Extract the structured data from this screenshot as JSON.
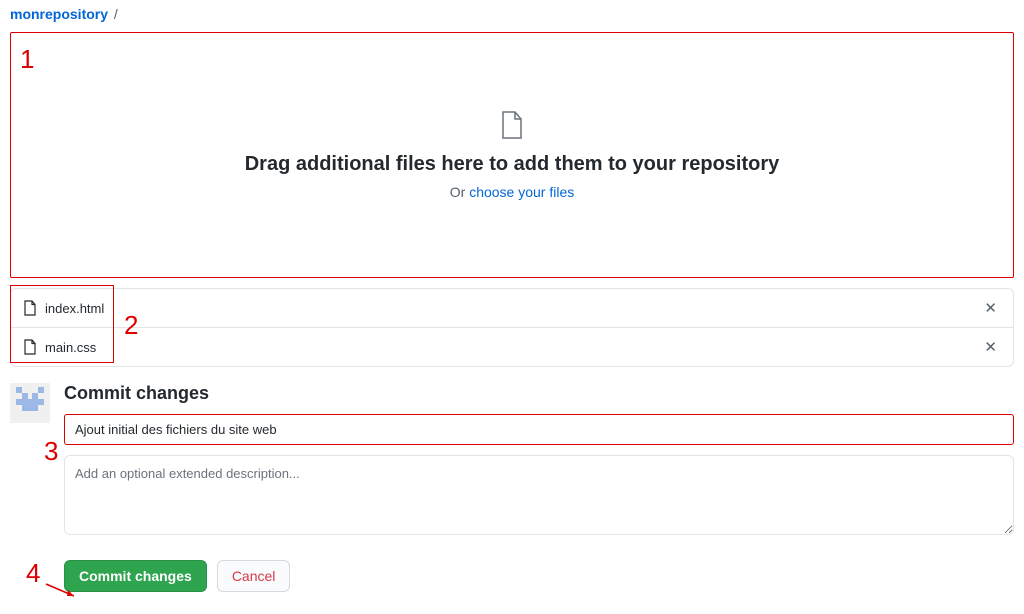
{
  "breadcrumb": {
    "repo": "monrepository",
    "sep": "/"
  },
  "dropzone": {
    "title": "Drag additional files here to add them to your repository",
    "or_prefix": "Or ",
    "choose_label": "choose your files"
  },
  "files": [
    {
      "name": "index.html"
    },
    {
      "name": "main.css"
    }
  ],
  "commit": {
    "heading": "Commit changes",
    "summary_value": "Ajout initial des fichiers du site web",
    "desc_placeholder": "Add an optional extended description...",
    "commit_btn": "Commit changes",
    "cancel_btn": "Cancel"
  },
  "annotations": {
    "n1": "1",
    "n2": "2",
    "n3": "3",
    "n4": "4"
  }
}
